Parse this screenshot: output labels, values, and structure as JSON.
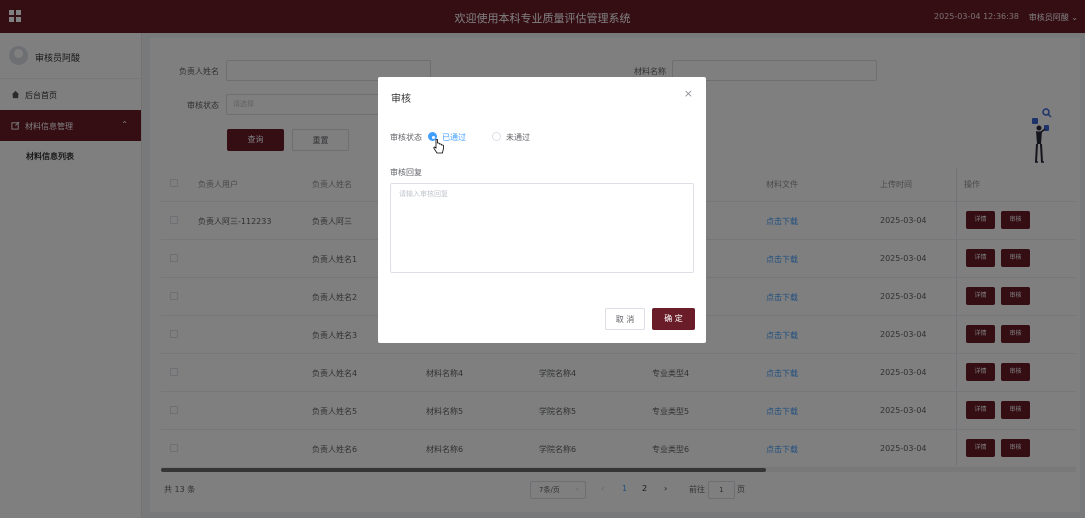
{
  "header": {
    "title": "欢迎使用本科专业质量评估管理系统",
    "datetime": "2025-03-04 12:36:38",
    "user": "审核员阿酸"
  },
  "sidebar": {
    "profile_name": "审核员阿酸",
    "items": [
      {
        "label": "后台首页",
        "icon": "home-icon"
      },
      {
        "label": "材料信息管理",
        "icon": "edit-icon"
      }
    ],
    "submenu_label": "材料信息列表"
  },
  "search": {
    "owner_label": "负责人姓名",
    "material_label": "材料名称",
    "status_label": "审核状态",
    "status_placeholder": "请选择",
    "query_button": "查询",
    "reset_button": "重置"
  },
  "table": {
    "headers": [
      "负责人用户",
      "负责人姓名",
      "材料文件",
      "上传时间",
      "操作"
    ],
    "rows": [
      {
        "user": "负责人阿三-112233",
        "name": "负责人阿三",
        "material": "",
        "college": "",
        "major": "",
        "file": "点击下载",
        "time": "2025-03-04"
      },
      {
        "user": "",
        "name": "负责人姓名1",
        "material": "",
        "college": "",
        "major": "",
        "file": "点击下载",
        "time": "2025-03-04"
      },
      {
        "user": "",
        "name": "负责人姓名2",
        "material": "",
        "college": "",
        "major": "",
        "file": "点击下载",
        "time": "2025-03-04"
      },
      {
        "user": "",
        "name": "负责人姓名3",
        "material": "",
        "college": "",
        "major": "",
        "file": "点击下载",
        "time": "2025-03-04"
      },
      {
        "user": "",
        "name": "负责人姓名4",
        "material": "材料名称4",
        "college": "学院名称4",
        "major": "专业类型4",
        "file": "点击下载",
        "time": "2025-03-04"
      },
      {
        "user": "",
        "name": "负责人姓名5",
        "material": "材料名称5",
        "college": "学院名称5",
        "major": "专业类型5",
        "file": "点击下载",
        "time": "2025-03-04"
      },
      {
        "user": "",
        "name": "负责人姓名6",
        "material": "材料名称6",
        "college": "学院名称6",
        "major": "专业类型6",
        "file": "点击下载",
        "time": "2025-03-04"
      }
    ],
    "detail_label": "详情",
    "audit_label": "审核"
  },
  "pagination": {
    "total": "共 13 条",
    "page_size": "7条/页",
    "pages": [
      "1",
      "2"
    ],
    "current": "1",
    "goto_prefix": "前往",
    "goto_value": "1",
    "goto_suffix": "页"
  },
  "dialog": {
    "title": "审核",
    "status_label": "审核状态",
    "option_passed": "已通过",
    "option_failed": "未通过",
    "selected": "已通过",
    "reply_label": "审核回复",
    "reply_placeholder": "请输入审核回复",
    "cancel_button": "取 消",
    "confirm_button": "确 定"
  },
  "colors": {
    "brand": "#6a1d29",
    "link": "#409eff"
  }
}
